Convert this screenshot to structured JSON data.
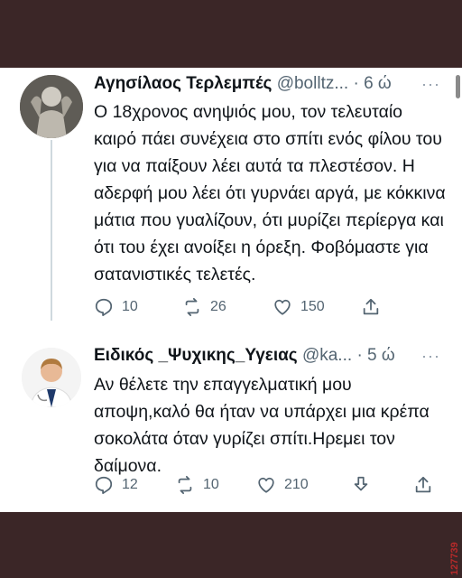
{
  "tweets": [
    {
      "name": "Αγησίλαος Τερλεμπές",
      "handle": "@bolltz...",
      "time": "· 6 ώ",
      "text": "Ο 18χρονος ανηψιός μου, τον τελευταίο καιρό πάει συνέχεια στο σπίτι ενός φίλου του για να παίξουν λέει αυτά τα πλεστέσον. Η αδερφή μου λέει ότι γυρνάει αργά, με κόκκινα μάτια που γυαλίζουν, ότι μυρίζει περίεργα και ότι του έχει ανοίξει η όρεξη. Φοβόμαστε για σατανιστικές τελετές.",
      "replies": "10",
      "retweets": "26",
      "likes": "150"
    },
    {
      "name": "Ειδικός _Ψυχικης_Υγειας",
      "handle": "@ka...",
      "time": "· 5 ώ",
      "text": "Αν θέλετε την επαγγελματική μου αποψη,καλό θα ήταν να υπάρχει μια κρέπα σοκολάτα όταν γυρίζει σπίτι.Ηρεμει τον δαίμονα.",
      "replies": "12",
      "retweets": "10",
      "likes": "210"
    }
  ],
  "more_glyph": "···",
  "watermark": "127739",
  "icons": [
    "reply-icon",
    "retweet-icon",
    "like-icon",
    "download-icon",
    "share-icon"
  ]
}
